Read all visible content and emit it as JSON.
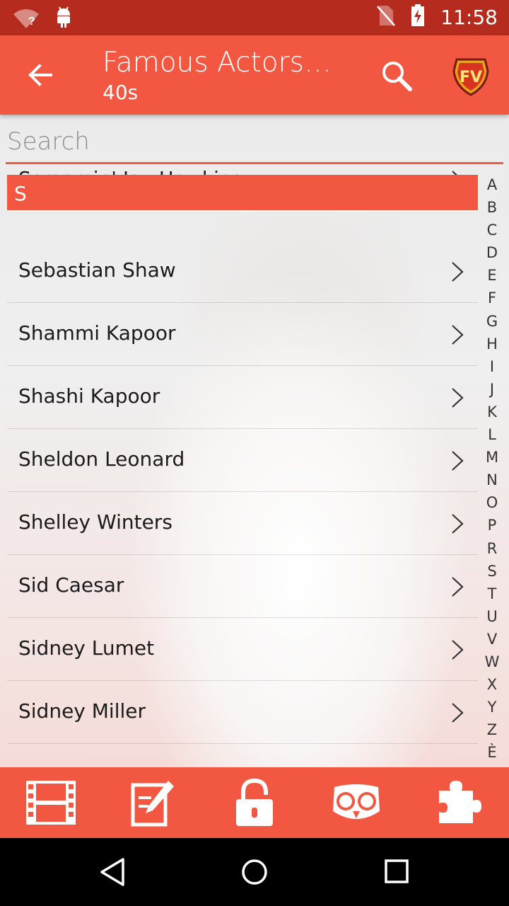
{
  "toolbar": {
    "title": "Famous Actors a…",
    "subtitle": "40s",
    "logo_text": "FV"
  },
  "status": {
    "time": "11:58",
    "wifi_badge": "?"
  },
  "search": {
    "placeholder": "Search"
  },
  "section": {
    "letter": "S"
  },
  "partial_row": {
    "name": "Screamin' Jay Hawkins"
  },
  "rows": [
    {
      "name": "Sebastian Shaw"
    },
    {
      "name": "Shammi Kapoor"
    },
    {
      "name": "Shashi Kapoor"
    },
    {
      "name": "Sheldon Leonard"
    },
    {
      "name": "Shelley Winters"
    },
    {
      "name": "Sid Caesar"
    },
    {
      "name": "Sidney Lumet"
    },
    {
      "name": "Sidney Miller"
    }
  ],
  "alphabet": [
    "A",
    "B",
    "C",
    "D",
    "E",
    "F",
    "G",
    "H",
    "I",
    "J",
    "K",
    "L",
    "M",
    "N",
    "O",
    "P",
    "R",
    "S",
    "T",
    "U",
    "V",
    "W",
    "X",
    "Y",
    "Z",
    "È"
  ],
  "tabs": [
    "film-icon",
    "edit-icon",
    "unlock-icon",
    "owl-icon",
    "puzzle-icon"
  ],
  "colors": {
    "primary": "#f25741",
    "status_bar": "#b52c1e"
  }
}
